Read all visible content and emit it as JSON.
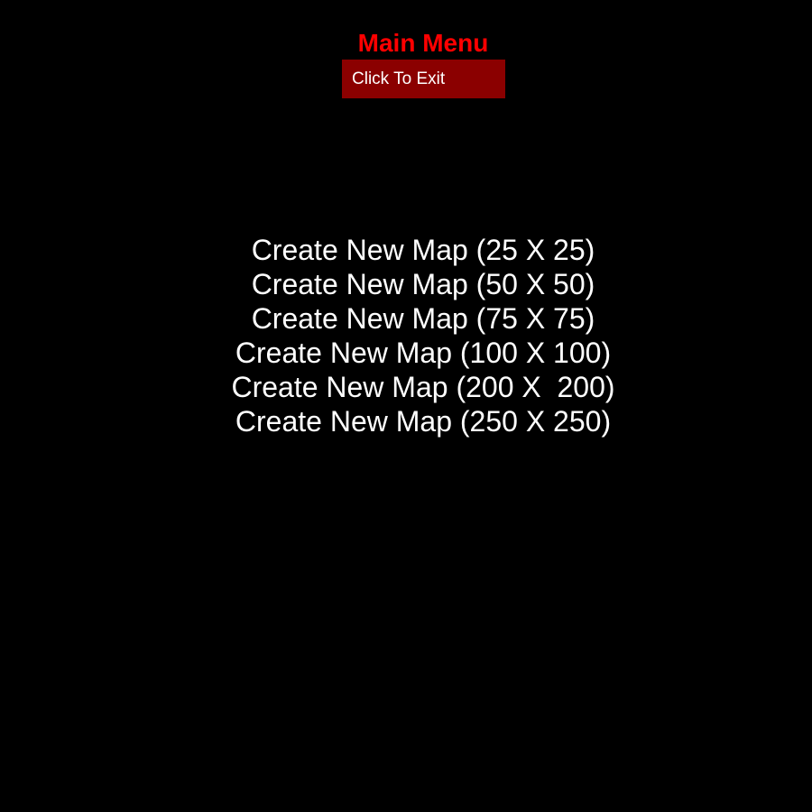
{
  "menu": {
    "title": "Main Menu",
    "exit_label": "Click To Exit",
    "options": [
      {
        "label": "Create New Map (25 X 25)"
      },
      {
        "label": "Create New Map (50 X 50)"
      },
      {
        "label": "Create New Map (75 X 75)"
      },
      {
        "label": "Create New Map (100 X 100)"
      },
      {
        "label": "Create New Map (200 X  200)"
      },
      {
        "label": "Create New Map (250 X 250)"
      }
    ]
  },
  "colors": {
    "background": "#000000",
    "title": "#ff0000",
    "exit_button_bg": "#8b0000",
    "text": "#ffffff"
  }
}
